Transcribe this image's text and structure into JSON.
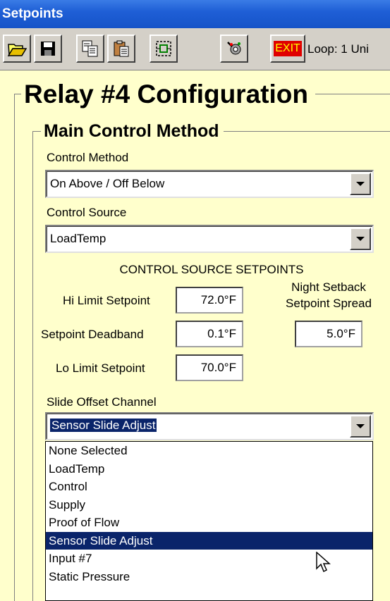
{
  "window": {
    "title": "Setpoints"
  },
  "toolbar": {
    "buttons": [
      {
        "icon": "open-folder-icon"
      },
      {
        "icon": "save-disk-icon"
      },
      {
        "icon": "copy-icon"
      },
      {
        "icon": "paste-icon"
      },
      {
        "icon": "select-frame-icon"
      },
      {
        "icon": "tools-icon"
      }
    ],
    "exit_label": "EXIT",
    "loop_info": "Loop: 1  Uni"
  },
  "page": {
    "title": "Relay #4 Configuration",
    "section_title": "Main Control Method"
  },
  "control_method": {
    "label": "Control Method",
    "value": "On Above / Off Below"
  },
  "control_source": {
    "label": "Control Source",
    "value": "LoadTemp"
  },
  "setpoints": {
    "heading": "CONTROL SOURCE SETPOINTS",
    "hi_limit_label": "Hi Limit Setpoint",
    "hi_limit_value": "72.0°F",
    "deadband_label": "Setpoint Deadband",
    "deadband_value": "0.1°F",
    "lo_limit_label": "Lo Limit Setpoint",
    "lo_limit_value": "70.0°F",
    "night_setback_label_1": "Night Setback",
    "night_setback_label_2": "Setpoint Spread",
    "night_setback_value": "5.0°F"
  },
  "slide_offset": {
    "label": "Slide Offset Channel",
    "value": "Sensor Slide Adjust",
    "options": [
      "None Selected",
      "LoadTemp",
      "Control",
      "Supply",
      "Proof of Flow",
      "Sensor Slide Adjust",
      "Input #7",
      "Static Pressure"
    ],
    "selected_index": 5
  },
  "colors": {
    "background": "#ffffcc",
    "titlebar": "#1f5fd6",
    "selection": "#0a246a",
    "exit_bg": "#e00000",
    "exit_text": "#ffff00"
  }
}
